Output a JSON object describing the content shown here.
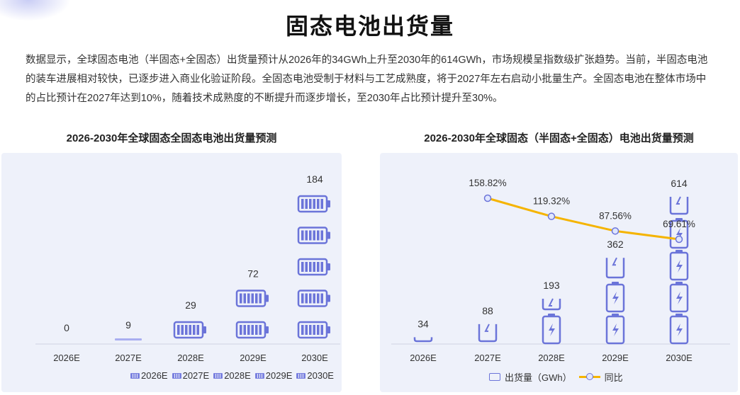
{
  "page": {
    "title": "固态电池出货量",
    "intro": "数据显示，全球固态电池（半固态+全固态）出货量预计从2026年的34GWh上升至2030年的614GWh，市场规模呈指数级扩张趋势。当前，半固态电池的装车进展相对较快，已逐步进入商业化验证阶段。全固态电池受制于材料与工艺成熟度，将于2027年左右启动小批量生产。全固态电池在整体市场中的占比预计在2027年达到10%，随着技术成熟度的不断提升而逐步增长，至2030年占比预计提升至30%。"
  },
  "colors": {
    "accent": "#6b74d9",
    "line": "#f5b400",
    "panel": "#eef1fa"
  },
  "chart_data": [
    {
      "type": "bar",
      "title": "2026-2030年全球固态全固态电池出货量预测",
      "categories": [
        "2026E",
        "2027E",
        "2028E",
        "2029E",
        "2030E"
      ],
      "values": [
        0,
        9,
        29,
        72,
        184
      ],
      "value_labels": [
        "0",
        "9",
        "29",
        "72",
        "184"
      ],
      "legend": [
        "2026E",
        "2027E",
        "2028E",
        "2029E",
        "2030E"
      ],
      "legend_placement": "bottom",
      "icon": "battery-horizontal-icon",
      "grid": false
    },
    {
      "type": "bar",
      "title": "2026-2030年全球固态（半固态+全固态）电池出货量预测",
      "categories": [
        "2026E",
        "2027E",
        "2028E",
        "2029E",
        "2030E"
      ],
      "series": [
        {
          "name": "出货量（GWh）",
          "type": "bar",
          "values": [
            34,
            88,
            193,
            362,
            614
          ],
          "labels": [
            "34",
            "88",
            "193",
            "362",
            "614"
          ]
        },
        {
          "name": "同比",
          "type": "line",
          "values": [
            null,
            158.82,
            119.32,
            87.56,
            69.61
          ],
          "labels": [
            "",
            "158.82%",
            "119.32%",
            "87.56%",
            "69.61%"
          ]
        }
      ],
      "legend": [
        "出货量（GWh）",
        "同比"
      ],
      "legend_placement": "bottom",
      "icon": "battery-vertical-bolt-icon",
      "grid": false
    }
  ]
}
